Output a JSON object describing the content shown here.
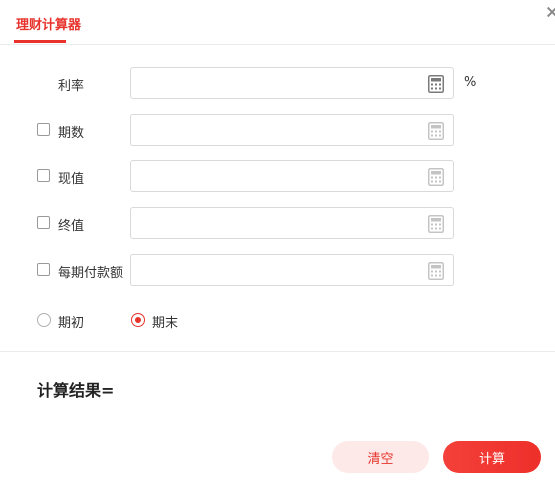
{
  "tab": {
    "label": "理财计算器"
  },
  "fields": {
    "rate": {
      "label": "利率",
      "value": "",
      "unit": "%"
    },
    "periods": {
      "label": "期数",
      "value": "",
      "checked": false
    },
    "present_value": {
      "label": "现值",
      "value": "",
      "checked": false
    },
    "future_value": {
      "label": "终值",
      "value": "",
      "checked": false
    },
    "payment": {
      "label": "每期付款额",
      "value": "",
      "checked": false
    }
  },
  "timing": {
    "options": [
      {
        "label": "期初",
        "selected": false
      },
      {
        "label": "期末",
        "selected": true
      }
    ]
  },
  "result": {
    "label": "计算结果="
  },
  "buttons": {
    "clear": "清空",
    "calculate": "计算"
  },
  "colors": {
    "accent": "#e8332c",
    "clear_bg": "#fde9e7"
  }
}
